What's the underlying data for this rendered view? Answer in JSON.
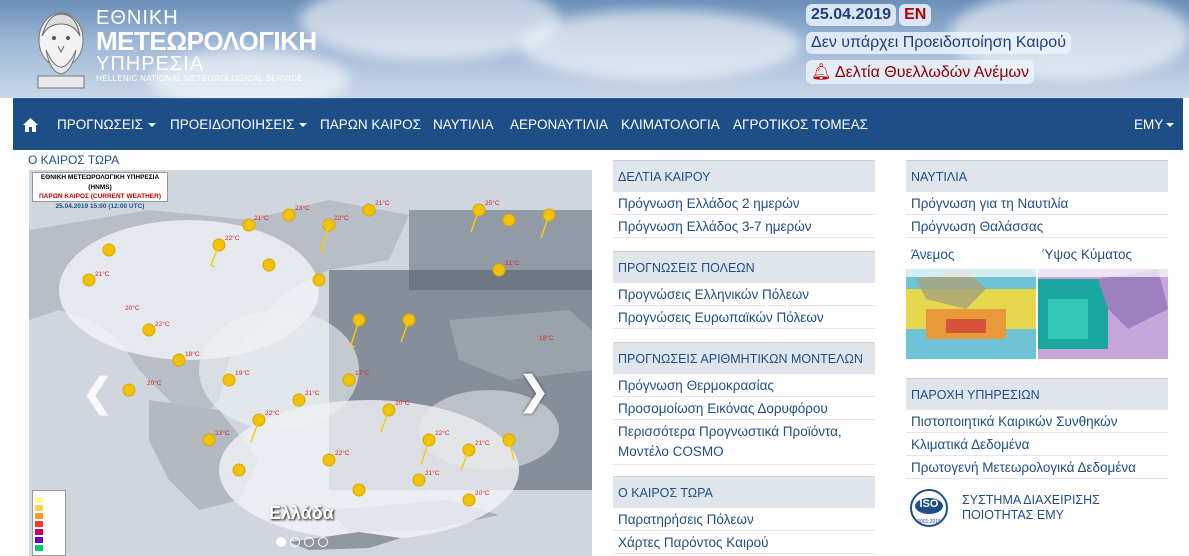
{
  "header": {
    "logo_line1": "ΕΘΝΙΚΗ",
    "logo_line2": "ΜΕΤΕΩΡΟΛΟΓΙΚΗ",
    "logo_line3": "ΥΠΗΡΕΣΙΑ",
    "logo_line4": "HELLENIC NATIONAL METEOROLOGICAL SERVICE",
    "date": "25.04.2019",
    "lang": "EN",
    "warning": "Δεν υπάρχει Προειδοποίηση Καιρού",
    "gale_bulletin": "Δελτία Θυελλωδών Ανέμων"
  },
  "nav": {
    "home_icon": "home-icon",
    "items": [
      "ΠΡΟΓΝΩΣΕΙΣ",
      "ΠΡΟΕΙΔΟΠΟΙΗΣΕΙΣ",
      "ΠΑΡΩΝ ΚΑΙΡΟΣ",
      "ΝΑΥΤΙΛΙΑ",
      "ΑΕΡΟΝΑΥΤΙΛΙΑ",
      "ΚΛΙΜΑΤΟΛΟΓΙΑ",
      "ΑΓΡΟΤΙΚΟΣ ΤΟΜΕΑΣ"
    ],
    "right": "ΕΜΥ"
  },
  "now": {
    "title": "Ο ΚΑΙΡΟΣ ΤΩΡΑ",
    "map_banner_1": "ΕΘΝΙΚΗ ΜΕΤΕΩΡΟΛΟΓΙΚΗ ΥΠΗΡΕΣΙΑ (HNMS)",
    "map_banner_2": "ΠΑΡΩΝ ΚΑΙΡΟΣ (CURRENT WEATHER)",
    "map_banner_3": "25.04.2019 15:00 (12:00 UTC)",
    "caption": "Ελλάδα",
    "slides": 4,
    "active_slide": 1
  },
  "col2": {
    "weather_bulletins": {
      "title": "ΔΕΛΤΙΑ ΚΑΙΡΟΥ",
      "items": [
        "Πρόγνωση Ελλάδος 2 ημερών",
        "Πρόγνωση Ελλάδος 3-7 ημερών"
      ]
    },
    "city_forecasts": {
      "title": "ΠΡΟΓΝΩΣΕΙΣ ΠΟΛΕΩΝ",
      "items": [
        "Προγνώσεις Ελληνικών Πόλεων",
        "Προγνώσεις Ευρωπαϊκών Πόλεων"
      ]
    },
    "numerical_models": {
      "title": "ΠΡΟΓΝΩΣΕΙΣ ΑΡΙΘΜΗΤΙΚΩΝ ΜΟΝΤΕΛΩΝ",
      "items": [
        "Πρόγνωση Θερμοκρασίας",
        "Προσομοίωση Εικόνας Δορυφόρου",
        "Περισσότερα Προγνωστικά Προϊόντα, Μοντέλο COSMO"
      ]
    },
    "weather_now": {
      "title": "Ο ΚΑΙΡΟΣ ΤΩΡΑ",
      "items": [
        "Παρατηρήσεις Πόλεων",
        "Χάρτες Παρόντος Καιρού"
      ]
    }
  },
  "col3": {
    "navigation": {
      "title": "ΝΑΥΤΙΛΙΑ",
      "items": [
        "Πρόγνωση για τη Ναυτιλία",
        "Πρόγνωση Θαλάσσας"
      ],
      "wind_label": "Άνεμος",
      "wave_label": "Ύψος Κύματος"
    },
    "services": {
      "title": "ΠΑΡΟΧΗ ΥΠΗΡΕΣΙΩΝ",
      "items": [
        "Πιστοποιητικά Καιρικών Συνθηκών",
        "Κλιματικά Δεδομένα",
        "Πρωτογενή Μετεωρολογικά Δεδομένα"
      ]
    },
    "quality": {
      "line1": "ΣΥΣΤΗΜΑ ΔΙΑΧΕΙΡΙΣΗΣ",
      "line2": "ΠΟΙΟΤΗΤΑΣ ΕΜΥ",
      "badge": "ISO",
      "badge_sub": "9001:2015"
    }
  },
  "colors": {
    "navbar": "#1d4f86",
    "link": "#1d4f86",
    "accent_red": "#b00000",
    "panel_head": "#dfe5eb"
  }
}
